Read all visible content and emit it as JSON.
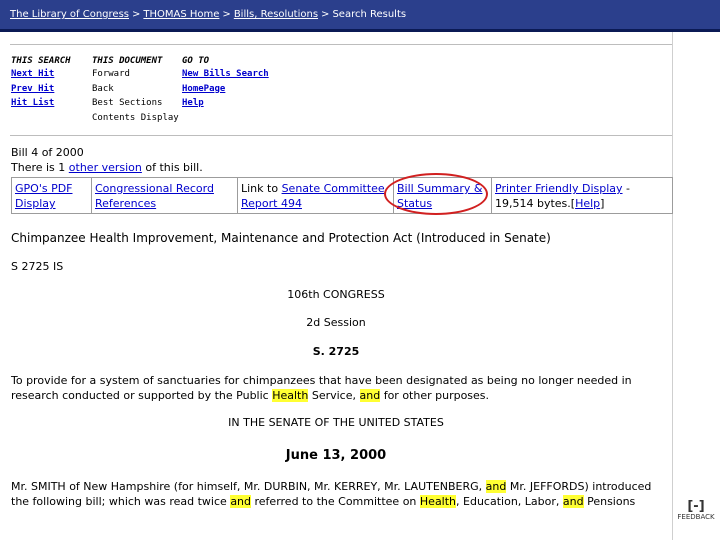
{
  "breadcrumb": {
    "items": [
      "The Library of Congress",
      "THOMAS Home",
      "Bills, Resolutions"
    ],
    "separator": ">",
    "current": "Search Results"
  },
  "nav": {
    "this_search": {
      "header": "THIS SEARCH",
      "items": [
        "Next Hit",
        "Prev Hit",
        "Hit List"
      ]
    },
    "this_document": {
      "header": "THIS DOCUMENT",
      "items": [
        "Forward",
        "Back",
        "Best Sections",
        "Contents Display"
      ]
    },
    "go_to": {
      "header": "GO TO",
      "items": [
        "New Bills Search",
        "HomePage",
        "Help"
      ]
    }
  },
  "bill_info": {
    "number_line": "Bill 4 of 2000",
    "other_prefix": "There is 1 ",
    "other_link": "other version",
    "other_suffix": " of this bill."
  },
  "links": {
    "gpo_pdf": "GPO's PDF Display",
    "congressional_record": "Congressional Record References",
    "committee_prefix": "Link to ",
    "committee_link": "Senate Committee Report 494",
    "bill_summary": "Bill Summary & Status",
    "printer_link": "Printer Friendly Display",
    "printer_suffix": " - 19,514 bytes.[",
    "help_link": "Help",
    "help_suffix": "]"
  },
  "bill": {
    "title": "Chimpanzee Health Improvement, Maintenance and Protection Act (Introduced in Senate)",
    "id": "S 2725 IS",
    "congress": "106th CONGRESS",
    "session": "2d Session",
    "number": "S. 2725",
    "purpose_1": "To provide for a system of sanctuaries for chimpanzees that have been designated as being no longer needed in research conducted or supported by the Public ",
    "purpose_hl_1": "Health",
    "purpose_2": " Service, ",
    "purpose_hl_2": "and",
    "purpose_3": " for other purposes.",
    "in_senate": "IN THE SENATE OF THE UNITED STATES",
    "date": "June 13, 2000",
    "intro_1": "Mr. SMITH of New Hampshire (for himself, Mr. DURBIN, Mr. KERREY, Mr. LAUTENBERG, ",
    "intro_hl_1": "and",
    "intro_2": " Mr. JEFFORDS) introduced the following bill; which was read twice ",
    "intro_hl_2": "and",
    "intro_3": " referred to the Committee on ",
    "intro_hl_3": "Health",
    "intro_4": ", Education, Labor, ",
    "intro_hl_4": "and",
    "intro_5": " Pensions"
  },
  "feedback": {
    "icon": "[-]",
    "label": "FEEDBACK"
  },
  "colors": {
    "topbar": "#2b3f8c",
    "link": "#0000cc",
    "highlight": "#ffff33",
    "annotation": "#d12020"
  }
}
